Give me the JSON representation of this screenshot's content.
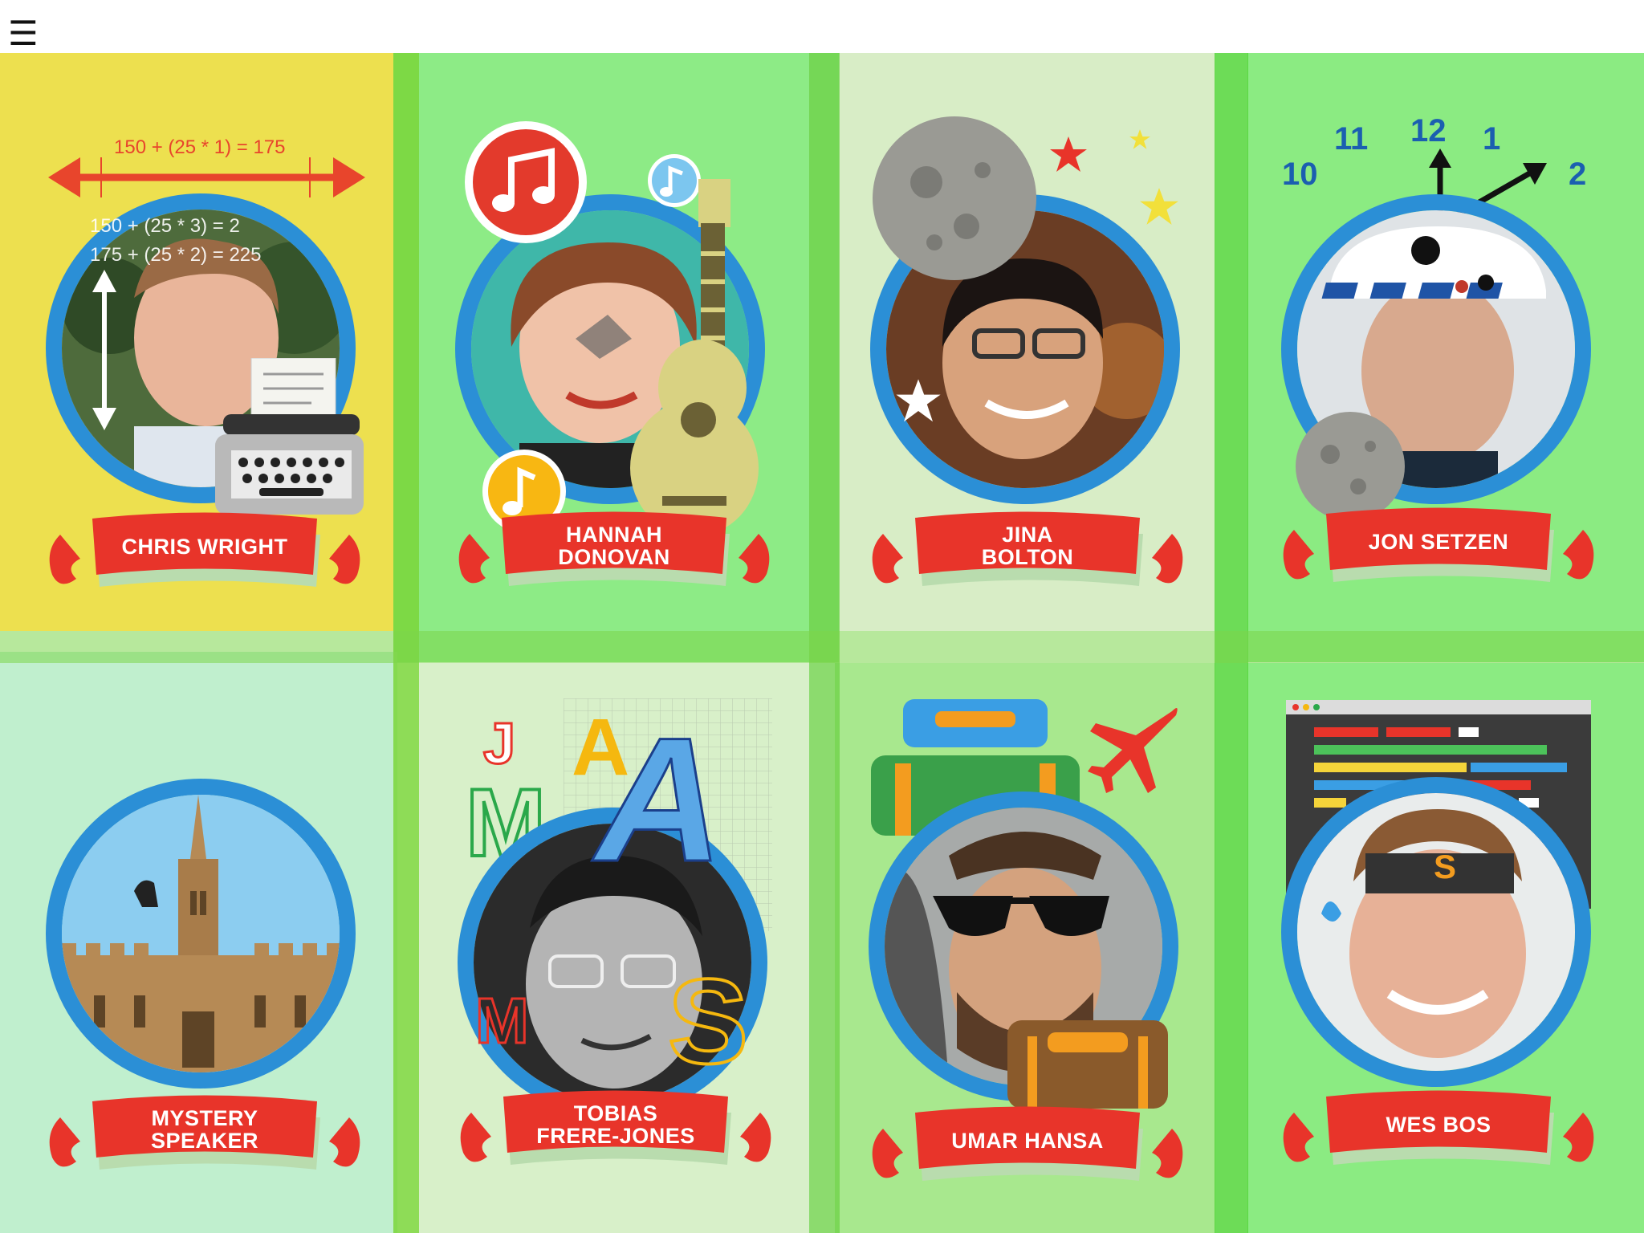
{
  "menu": {
    "icon_glyph": "☰",
    "icon": "hamburger-menu-icon"
  },
  "speakers": [
    {
      "name": "CHRIS WRIGHT",
      "bg": "#ede04f",
      "props": [
        "arrows-icon",
        "typewriter-icon"
      ],
      "formula_top": "150 + (25 * 1) = 175",
      "formula_mid1": "150 + (25 * 3) = 2",
      "formula_mid2": "175 + (25 * 2) = 225"
    },
    {
      "name": "HANNAH\nDONOVAN",
      "bg": "#8deb86",
      "props": [
        "music-note-icon",
        "guitar-icon"
      ]
    },
    {
      "name": "JINA\nBOLTON",
      "bg": "#d8edc6",
      "props": [
        "moon-icon",
        "star-icon"
      ]
    },
    {
      "name": "JON SETZEN",
      "bg": "#8beb82",
      "props": [
        "robot-head-icon",
        "clock-icon"
      ],
      "clock_numbers": [
        "10",
        "11",
        "12",
        "1",
        "2"
      ]
    },
    {
      "name": "MYSTERY SPEAKER",
      "bg": "#c0efce",
      "props": [
        "cathedral-icon"
      ]
    },
    {
      "name": "TOBIAS\nFRERE-JONES",
      "bg": "#d8f0c9",
      "props": [
        "letter-icon"
      ],
      "letters": [
        "J",
        "A",
        "M",
        "A",
        "M",
        "S"
      ]
    },
    {
      "name": "UMAR HANSA",
      "bg": "#a8e88e",
      "props": [
        "sunglasses-icon",
        "airplane-icon",
        "backpack-icon"
      ]
    },
    {
      "name": "WES BOS",
      "bg": "#8beb82",
      "props": [
        "code-editor-icon",
        "headband-icon"
      ],
      "headband_letter": "S"
    }
  ],
  "colors": {
    "ring": "#2b8fd6",
    "banner": "#e8342a",
    "banner_shadow": "#b9dcae"
  }
}
